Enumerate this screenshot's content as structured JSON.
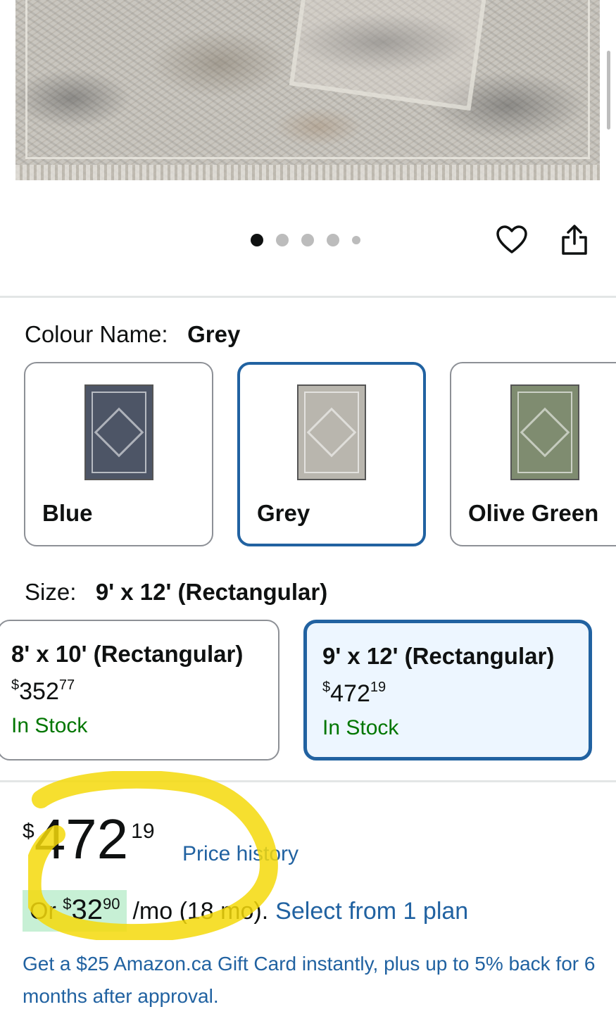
{
  "gallery": {
    "dots_count": 5,
    "active_index": 0
  },
  "colour": {
    "label": "Colour Name:",
    "selected": "Grey",
    "options": [
      {
        "name": "Blue",
        "swatch": "#4d5566"
      },
      {
        "name": "Grey",
        "swatch": "#b9b6ae"
      },
      {
        "name": "Olive Green",
        "swatch": "#7f8c70"
      }
    ]
  },
  "size": {
    "label": "Size:",
    "selected": "9' x 12' (Rectangular)",
    "options": [
      {
        "name": "8' x 10' (Rectangular)",
        "price_symbol": "$",
        "price_whole": "352",
        "price_frac": "77",
        "stock": "In Stock"
      },
      {
        "name": "9' x 12' (Rectangular)",
        "price_symbol": "$",
        "price_whole": "472",
        "price_frac": "19",
        "stock": "In Stock"
      }
    ]
  },
  "price": {
    "symbol": "$",
    "whole": "472",
    "fraction": "19",
    "history_link": "Price history"
  },
  "installment": {
    "prefix": "Or ",
    "symbol": "$",
    "whole": "32",
    "fraction": "90",
    "term": "/mo (18 mo).",
    "link": "Select from 1 plan"
  },
  "promo": {
    "text": "Get a $25 Amazon.ca Gift Card instantly, plus up to 5% back for 6 months after approval."
  },
  "colors": {
    "link": "#2162a1",
    "in_stock": "#007600",
    "highlight": "#c7f0d5",
    "annotation": "#f5d90a"
  }
}
